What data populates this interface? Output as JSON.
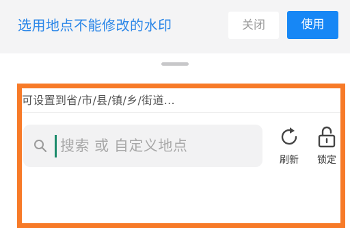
{
  "header": {
    "title": "选用地点不能修改的水印",
    "close_label": "关闭",
    "use_label": "使用"
  },
  "panel": {
    "hint": "可设置到省/市/县/镇/乡/街道...",
    "search": {
      "placeholder": "搜索 或 自定义地点",
      "icon": "search-icon"
    },
    "tools": {
      "refresh_label": "刷新",
      "refresh_icon": "refresh-icon",
      "lock_label": "锁定",
      "lock_icon": "unlock-icon"
    }
  },
  "colors": {
    "accent": "#1787f5",
    "title": "#2a86e8",
    "highlight_border": "#f77a28",
    "caret": "#1a8a6a"
  }
}
